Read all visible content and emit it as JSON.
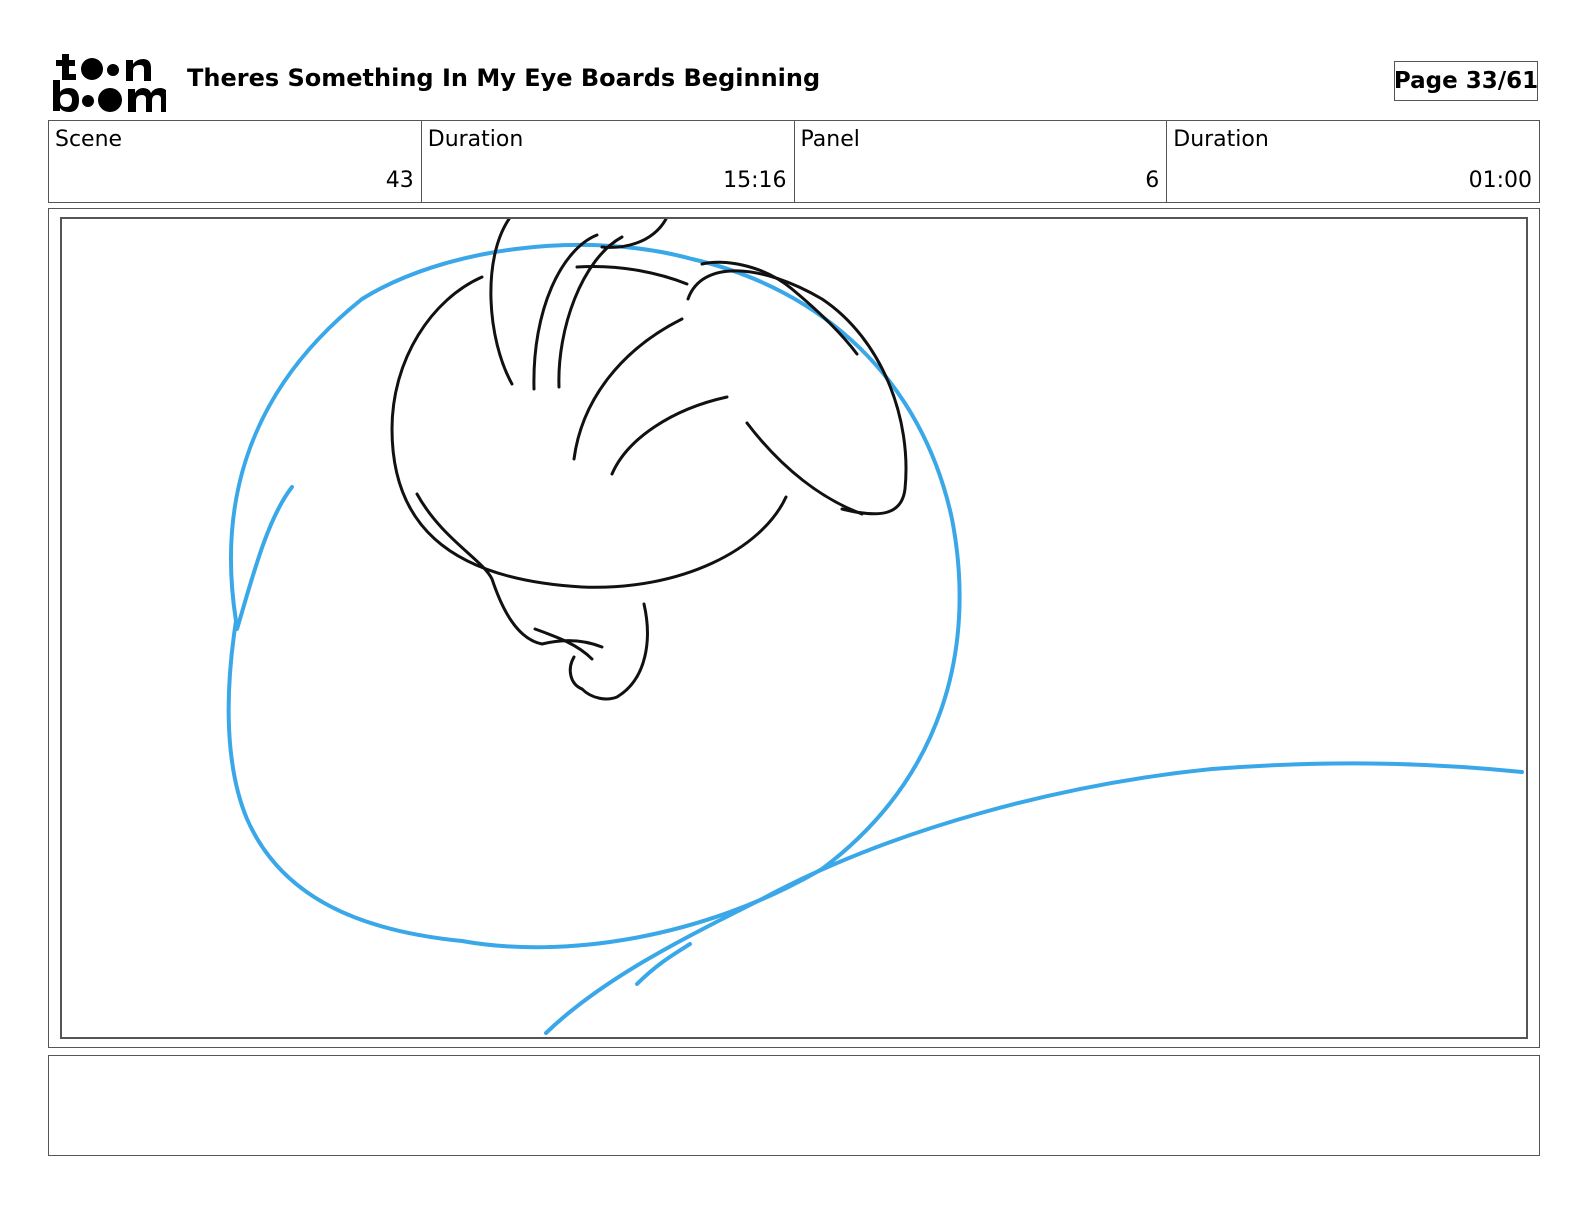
{
  "header": {
    "logo_icon": "toon-boom-logo-icon",
    "title": "Theres Something In My Eye Boards Beginning",
    "page": "Page 33/61"
  },
  "info": {
    "scene_label": "Scene",
    "scene_value": "43",
    "scene_duration_label": "Duration",
    "scene_duration_value": "15:16",
    "panel_label": "Panel",
    "panel_value": "6",
    "panel_duration_label": "Duration",
    "panel_duration_value": "01:00"
  },
  "panel": {
    "sketch_colors": {
      "ink": "#111111",
      "rough": "#3aa8e8"
    }
  },
  "notes": {
    "text": ""
  }
}
